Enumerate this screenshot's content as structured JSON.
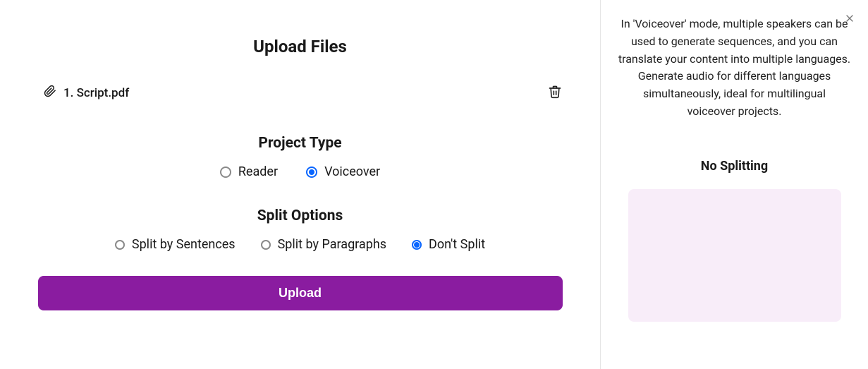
{
  "page": {
    "title": "Upload Files"
  },
  "file": {
    "label": "1. Script.pdf"
  },
  "projectType": {
    "heading": "Project Type",
    "options": [
      {
        "label": "Reader",
        "checked": false
      },
      {
        "label": "Voiceover",
        "checked": true
      }
    ]
  },
  "splitOptions": {
    "heading": "Split Options",
    "options": [
      {
        "label": "Split by Sentences",
        "checked": false
      },
      {
        "label": "Split by Paragraphs",
        "checked": false
      },
      {
        "label": "Don't Split",
        "checked": true
      }
    ]
  },
  "buttons": {
    "upload": "Upload"
  },
  "sidebar": {
    "infoText": "In 'Voiceover' mode, multiple speakers can be used to generate sequences, and you can translate your content into multiple languages. Generate audio for different languages simultaneously, ideal for multilingual voiceover projects.",
    "noSplitTitle": "No Splitting"
  }
}
